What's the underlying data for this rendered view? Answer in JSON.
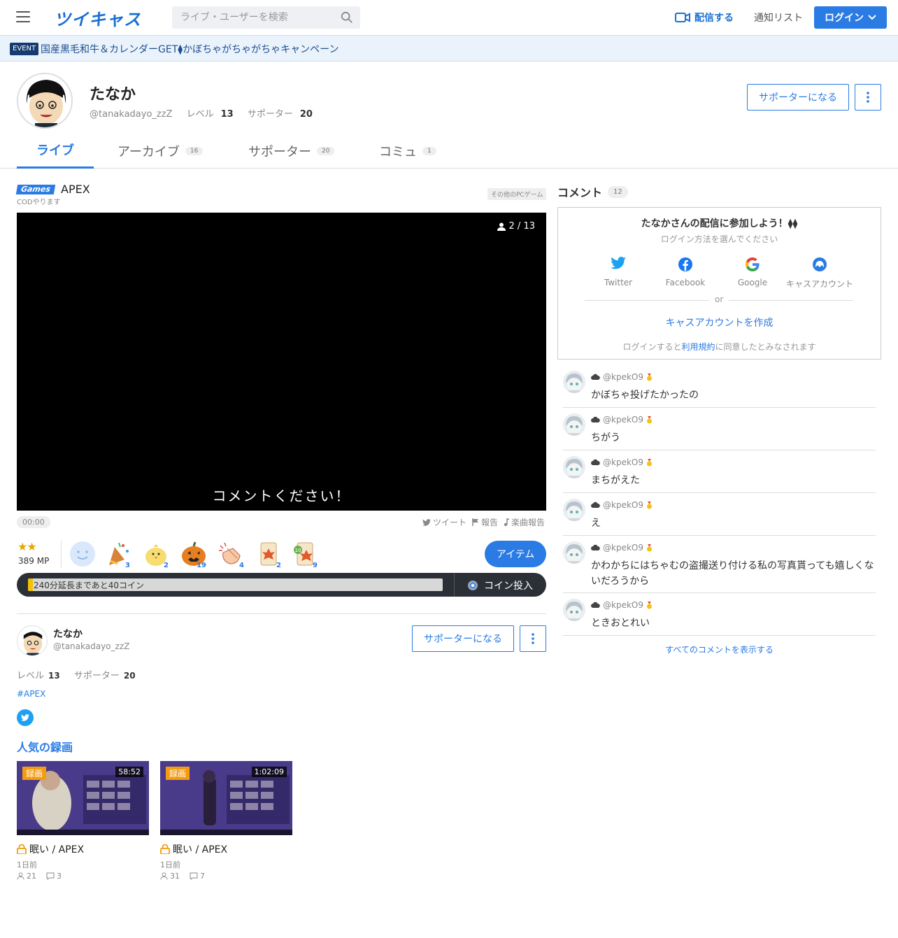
{
  "header": {
    "logo": "ツイキャス",
    "search_placeholder": "ライブ・ユーザーを検索",
    "broadcast_label": "配信する",
    "notif_label": "通知リスト",
    "login_label": "ログイン"
  },
  "event": {
    "badge": "EVENT",
    "text": "国産黒毛和牛＆カレンダーGET⧫かぼちゃがちゃがちゃキャンペーン"
  },
  "profile": {
    "name": "たなか",
    "handle": "@tanakadayo_zzZ",
    "level_label": "レベル",
    "level": "13",
    "supporter_label": "サポーター",
    "supporters": "20",
    "support_button": "サポーターになる"
  },
  "tabs": [
    {
      "label": "ライブ",
      "count": ""
    },
    {
      "label": "アーカイブ",
      "count": "16"
    },
    {
      "label": "サポーター",
      "count": "20"
    },
    {
      "label": "コミュ",
      "count": "1"
    }
  ],
  "live": {
    "category_badge": "Games",
    "title": "APEX",
    "subtitle": "CODやります",
    "category_tag": "その他のPCゲーム",
    "viewers": "2 / 13",
    "caption": "コメントください！",
    "time": "00:00",
    "share": {
      "tweet": "ツイート",
      "report": "報告",
      "music": "楽曲報告"
    },
    "stars": "★★",
    "mp": "389 MP",
    "gifts": [
      {
        "name": "smile",
        "count": ""
      },
      {
        "name": "party",
        "count": "3"
      },
      {
        "name": "chick",
        "count": "2"
      },
      {
        "name": "pumpkin",
        "count": "19"
      },
      {
        "name": "clap",
        "count": "4"
      },
      {
        "name": "leaf-card",
        "count": "2"
      },
      {
        "name": "leaf-ten",
        "count": "9"
      }
    ],
    "item_button": "アイテム",
    "coin_progress": 0.012,
    "coin_progress_text": "240分延長まであと40コイン",
    "coin_button": "コイン投入"
  },
  "broadcaster": {
    "name": "たなか",
    "handle": "@tanakadayo_zzZ",
    "level_label": "レベル",
    "level": "13",
    "supporter_label": "サポーター",
    "supporters": "20",
    "support_button": "サポーターになる",
    "hashtag": "#APEX",
    "popular_title": "人気の録画"
  },
  "recordings": [
    {
      "badge": "録画",
      "duration": "58:52",
      "title": "眠い / APEX",
      "ago": "1日前",
      "views": "21",
      "comments": "3"
    },
    {
      "badge": "録画",
      "duration": "1:02:09",
      "title": "眠い / APEX",
      "ago": "1日前",
      "views": "31",
      "comments": "7"
    }
  ],
  "comments_panel": {
    "title": "コメント",
    "count": "12",
    "login_title": "たなかさんの配信に参加しよう！⧫⧫",
    "login_sub": "ログイン方法を選んでください",
    "providers": [
      "Twitter",
      "Facebook",
      "Google",
      "キャスアカウント"
    ],
    "or": "or",
    "create": "キャスアカウントを作成",
    "terms_pre": "ログインすると",
    "terms_link": "利用規約",
    "terms_post": "に同意したとみなされます",
    "show_all": "すべてのコメントを表示する"
  },
  "comments": [
    {
      "user": "@kpekO9",
      "text": "かぼちゃ投げたかったの"
    },
    {
      "user": "@kpekO9",
      "text": "ちがう"
    },
    {
      "user": "@kpekO9",
      "text": "まちがえた"
    },
    {
      "user": "@kpekO9",
      "text": "え"
    },
    {
      "user": "@kpekO9",
      "text": "かわかちにはちゃむの盗撮送り付ける私の写真貰っても嬉しくないだろうから"
    },
    {
      "user": "@kpekO9",
      "text": "ときおとれい"
    }
  ],
  "colors": {
    "accent": "#2a7be4",
    "event_bg": "#eaf3fc",
    "coin_fill": "#f2c200"
  }
}
